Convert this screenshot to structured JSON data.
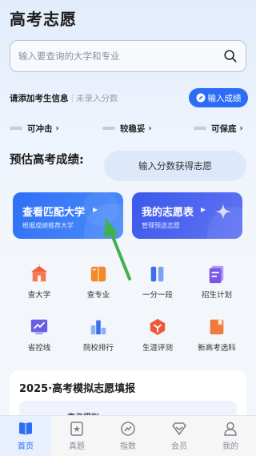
{
  "app": {
    "title": "高考志愿"
  },
  "search": {
    "placeholder": "输入要查询的大学和专业",
    "icon": "search-icon"
  },
  "student_info": {
    "prompt": "请添加考生信息",
    "separator": "|",
    "status": "未录入分数"
  },
  "score_button": {
    "label": "输入成绩",
    "icon": "edit-icon"
  },
  "tiers": [
    {
      "label": "可冲击"
    },
    {
      "label": "较稳妥"
    },
    {
      "label": "可保底"
    }
  ],
  "estimate": {
    "label": "预估高考成绩:",
    "input_text": "输入分数获得志愿"
  },
  "cards": {
    "match": {
      "title": "查看匹配大学",
      "subtitle": "根据成绩推荐大学"
    },
    "my_list": {
      "title": "我的志愿表",
      "subtitle": "管理预选志愿"
    }
  },
  "grid": [
    {
      "label": "查大学",
      "icon": "university-icon"
    },
    {
      "label": "查专业",
      "icon": "book-icon"
    },
    {
      "label": "一分一段",
      "icon": "score-segment-icon"
    },
    {
      "label": "招生计划",
      "icon": "plan-icon"
    },
    {
      "label": "省控线",
      "icon": "trend-chart-icon"
    },
    {
      "label": "院校排行",
      "icon": "ranking-icon"
    },
    {
      "label": "生涯评测",
      "icon": "assessment-icon"
    },
    {
      "label": "新高考选科",
      "icon": "subject-select-icon"
    }
  ],
  "section": {
    "title": "2025·高考模拟志愿填报",
    "inner_text": "高考模拟"
  },
  "tabbar": [
    {
      "label": "首页",
      "icon": "home-icon",
      "active": true
    },
    {
      "label": "真题",
      "icon": "exam-icon",
      "active": false
    },
    {
      "label": "指数",
      "icon": "gauge-icon",
      "active": false
    },
    {
      "label": "会员",
      "icon": "member-icon",
      "active": false
    },
    {
      "label": "我的",
      "icon": "profile-icon",
      "active": false
    }
  ],
  "colors": {
    "accent": "#2d6cf5",
    "pointer": "#3fb24b"
  }
}
